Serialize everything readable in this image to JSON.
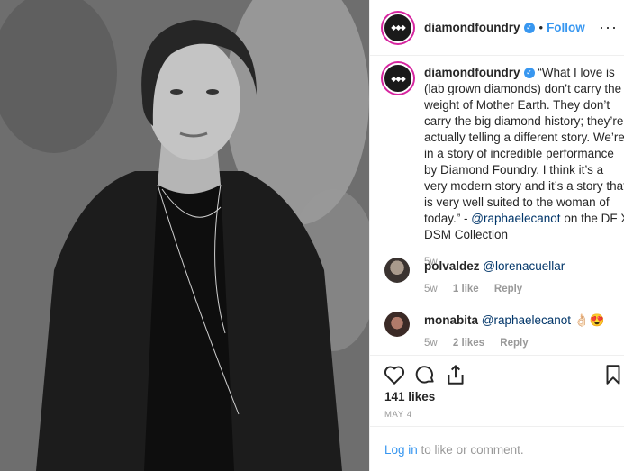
{
  "header": {
    "username": "diamondfoundry",
    "dot": "•",
    "follow_label": "Follow",
    "more_label": "···"
  },
  "caption": {
    "username": "diamondfoundry",
    "text_before": "“What I love is (lab grown diamonds) don’t carry the weight of Mother Earth. They don’t carry the big diamond history; they’re actually telling a different story. We’re in a story of incredible performance by Diamond Foundry. I think it’s a very modern story and it’s a story that is very well suited to the woman of today.” - ",
    "mention": "@raphaelecanot",
    "text_after": " on the DF X DSM Collection",
    "time": "5w"
  },
  "comments": [
    {
      "username": "polvaldez",
      "mention": "@lorenacuellar",
      "emoji": "",
      "time": "5w",
      "likes": "1 like",
      "reply": "Reply"
    },
    {
      "username": "monabita",
      "mention": "@raphaelecanot",
      "emoji": "👌🏻😍",
      "time": "5w",
      "likes": "2 likes",
      "reply": "Reply"
    }
  ],
  "actions": {
    "icons": [
      "heart-icon",
      "comment-icon",
      "share-icon",
      "bookmark-icon"
    ],
    "likes": "141 likes",
    "date": "MAY 4"
  },
  "footer": {
    "login_label": "Log in",
    "rest": " to like or comment."
  },
  "colors": {
    "link": "#3897f0",
    "mention": "#003569",
    "muted": "#999999",
    "verified": "#3897f0"
  }
}
